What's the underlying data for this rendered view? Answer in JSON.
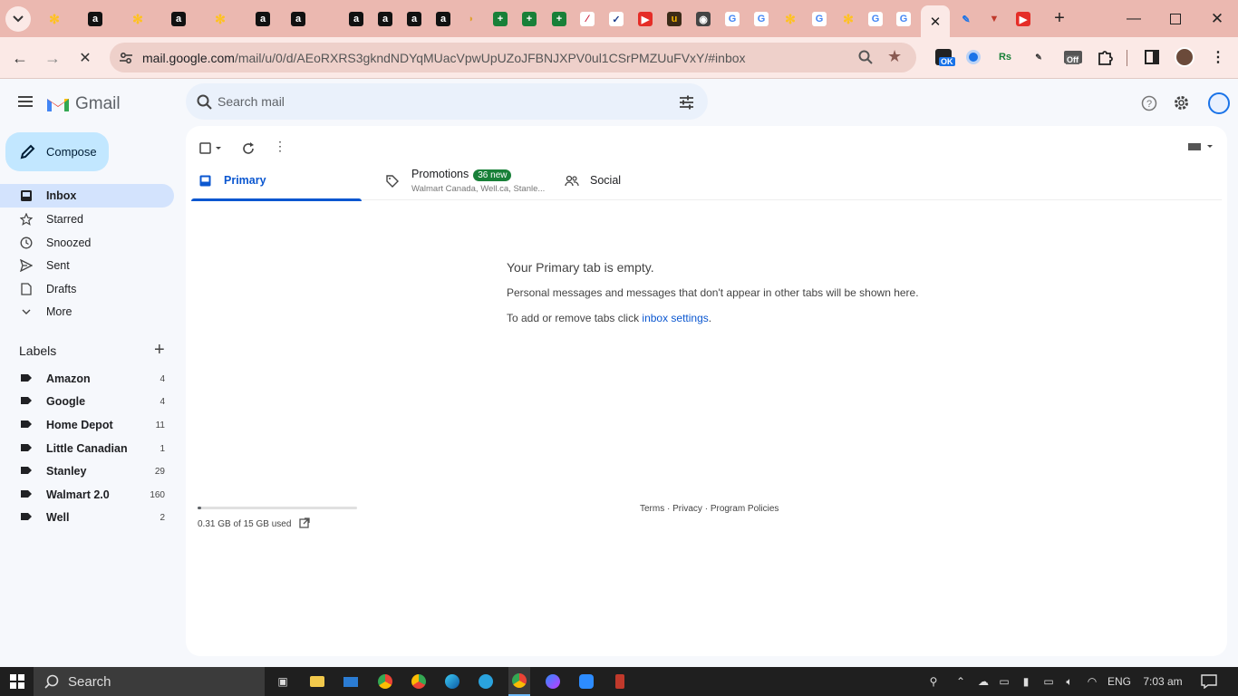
{
  "browser": {
    "url_host": "mail.google.com",
    "url_path": "/mail/u/0/d/AEoRXRS3gkndNDYqMUacVpwUpUZoJFBNJXPV0ul1CSrPMZUuFVxY/#inbox",
    "tab_icons": [
      "walmart-icon",
      "amazon-icon",
      "walmart-icon",
      "amazon-icon",
      "walmart-icon",
      "amazon-icon",
      "amazon-icon",
      "amazon-icon",
      "amazon-icon",
      "amazon-icon",
      "amazon-icon",
      "taco-icon",
      "plus-green-icon",
      "plus-green-icon",
      "plus-green-icon",
      "macys-icon",
      "tickets-icon",
      "youtube-icon",
      "ups-icon",
      "chrome-icon",
      "google-icon",
      "google-icon",
      "walmart-icon",
      "google-icon",
      "walmart-icon",
      "google-icon",
      "google-icon",
      "gmail-icon",
      "multicolor-icon",
      "wealthsimple-icon",
      "youtube-icon"
    ],
    "ext_badges": {
      "ok": "OK",
      "rs": "Rs",
      "off": "Off"
    }
  },
  "gmail": {
    "logo_text": "Gmail",
    "search_placeholder": "Search mail",
    "compose_label": "Compose",
    "nav": [
      {
        "label": "Inbox",
        "icon": "inbox-icon",
        "selected": true
      },
      {
        "label": "Starred",
        "icon": "star-icon"
      },
      {
        "label": "Snoozed",
        "icon": "clock-icon"
      },
      {
        "label": "Sent",
        "icon": "send-icon"
      },
      {
        "label": "Drafts",
        "icon": "draft-icon"
      },
      {
        "label": "More",
        "icon": "chevron-down-icon"
      }
    ],
    "labels_heading": "Labels",
    "labels": [
      {
        "name": "Amazon",
        "count": "4"
      },
      {
        "name": "Google",
        "count": "4"
      },
      {
        "name": "Home Depot",
        "count": "11"
      },
      {
        "name": "Little Canadian",
        "count": "1"
      },
      {
        "name": "Stanley",
        "count": "29"
      },
      {
        "name": "Walmart 2.0",
        "count": "160"
      },
      {
        "name": "Well",
        "count": "2"
      }
    ],
    "tabs": {
      "primary": "Primary",
      "promotions": "Promotions",
      "promotions_badge": "36 new",
      "promotions_snippet": "Walmart Canada, Well.ca, Stanle...",
      "social": "Social"
    },
    "empty": {
      "title": "Your Primary tab is empty.",
      "line1": "Personal messages and messages that don't appear in other tabs will be shown here.",
      "line2_prefix": "To add or remove tabs click ",
      "line2_link": "inbox settings",
      "line2_suffix": "."
    },
    "storage": {
      "text": "0.31 GB of 15 GB used",
      "used_fraction": 0.021
    },
    "footer": {
      "terms": "Terms",
      "privacy": "Privacy",
      "policies": "Program Policies",
      "sep": " · "
    }
  },
  "taskbar": {
    "search_label": "Search",
    "lang": "ENG",
    "time": "7:03 am"
  }
}
